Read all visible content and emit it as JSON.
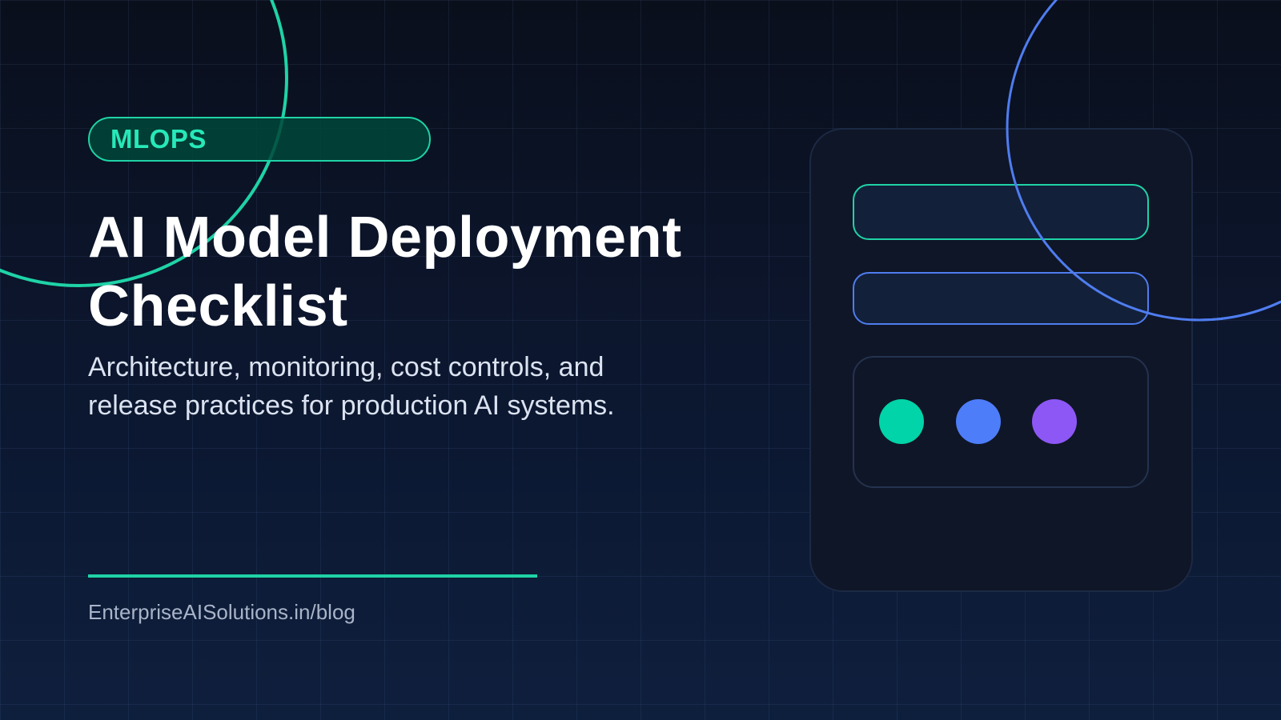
{
  "badge": {
    "label": "MLOPS"
  },
  "hero": {
    "title": "AI Model Deployment Checklist",
    "subtitle": "Architecture, monitoring, cost controls, and release practices for production AI systems."
  },
  "footer": {
    "site": "EnterpriseAISolutions.in/blog"
  },
  "colors": {
    "accent_green": "#1fd3a6",
    "accent_blue": "#4f7df0",
    "accent_purple": "#8d57f5",
    "background_top": "#0a0f1c",
    "background_bottom": "#0e1f3d"
  }
}
